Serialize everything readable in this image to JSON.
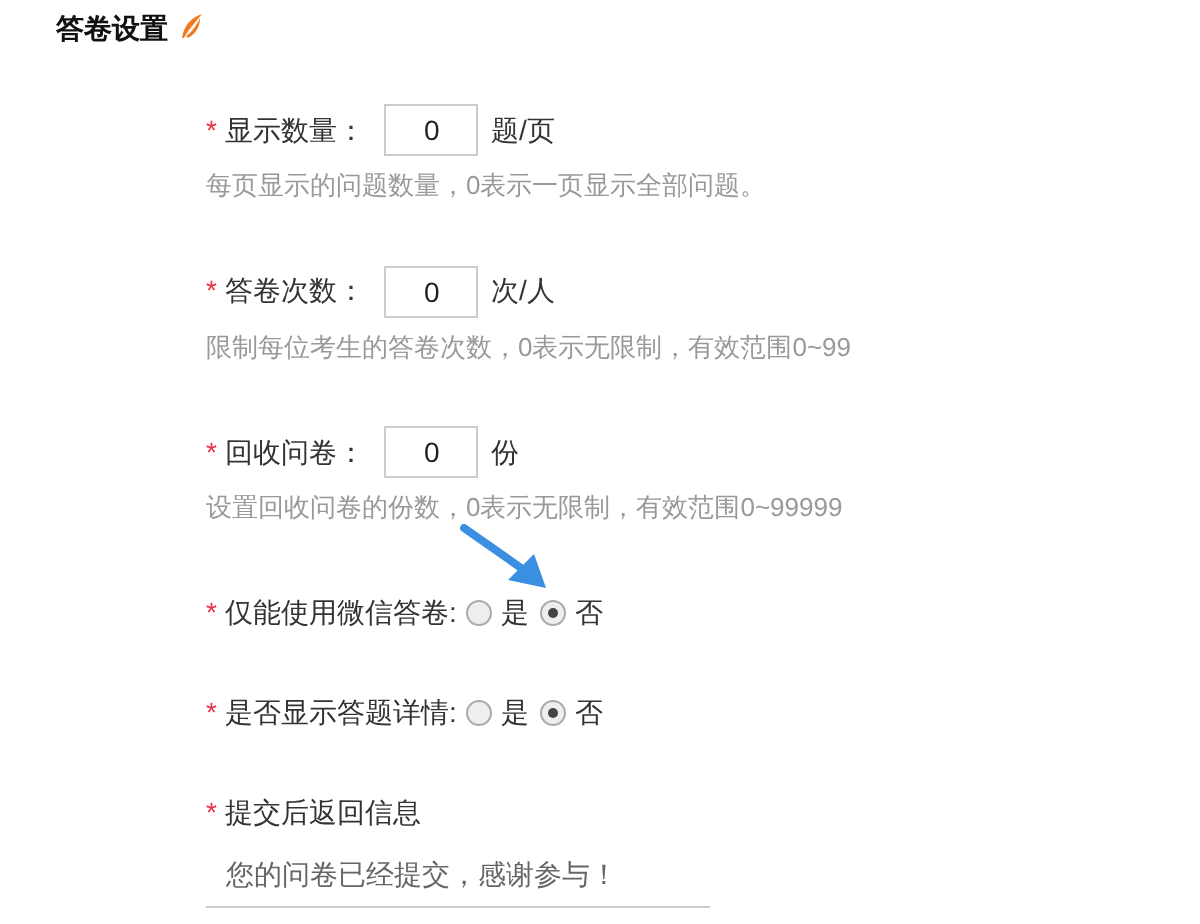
{
  "section": {
    "title": "答卷设置"
  },
  "fields": [
    {
      "kind": "number",
      "marker": "*",
      "label": "显示数量：",
      "value": "0",
      "unit": "题/页",
      "hint": "每页显示的问题数量，0表示一页显示全部问题。"
    },
    {
      "kind": "number",
      "marker": "*",
      "label": "答卷次数：",
      "value": "0",
      "unit": "次/人",
      "hint": "限制每位考生的答卷次数，0表示无限制，有效范围0~99"
    },
    {
      "kind": "number",
      "marker": "*",
      "label": "回收问卷：",
      "value": "0",
      "unit": "份",
      "hint": "设置回收问卷的份数，0表示无限制，有效范围0~99999"
    },
    {
      "kind": "radio",
      "marker": "*",
      "label": "仅能使用微信答卷:",
      "options": [
        {
          "label": "是",
          "selected": false
        },
        {
          "label": "否",
          "selected": true
        }
      ]
    },
    {
      "kind": "radio",
      "marker": "*",
      "label": "是否显示答题详情:",
      "options": [
        {
          "label": "是",
          "selected": false
        },
        {
          "label": "否",
          "selected": true
        }
      ]
    },
    {
      "kind": "text",
      "marker": "*",
      "label": "提交后返回信息",
      "value": "您的问卷已经提交，感谢参与！"
    }
  ]
}
